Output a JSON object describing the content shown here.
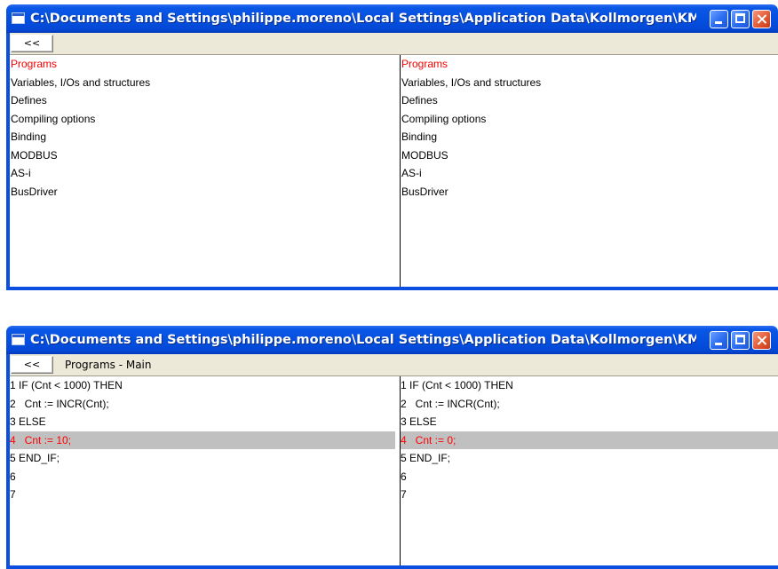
{
  "windows": [
    {
      "title": "C:\\Documents and Settings\\philippe.moreno\\Local Settings\\Application Data\\Kollmorgen\\KMS...",
      "back_label": "<<",
      "left_items": [
        "Programs",
        "Variables, I/Os and structures",
        "Defines",
        "Compiling options",
        "Binding",
        "MODBUS",
        "AS-i",
        "BusDriver"
      ],
      "right_items": [
        "Programs",
        "Variables, I/Os and structures",
        "Defines",
        "Compiling options",
        "Binding",
        "MODBUS",
        "AS-i",
        "BusDriver"
      ],
      "highlight_color": "#ff0000"
    },
    {
      "title": "C:\\Documents and Settings\\philippe.moreno\\Local Settings\\Application Data\\Kollmorgen\\KMS...",
      "back_label": "<<",
      "breadcrumb": "Programs - Main",
      "left_lines": [
        {
          "num": "1",
          "code": "IF (Cnt < 1000) THEN"
        },
        {
          "num": "2",
          "code": "  Cnt := INCR(Cnt);"
        },
        {
          "num": "3",
          "code": "ELSE"
        },
        {
          "num": "4",
          "code": "  Cnt := 10;"
        },
        {
          "num": "5",
          "code": "END_IF;"
        },
        {
          "num": "6",
          "code": ""
        },
        {
          "num": "7",
          "code": ""
        }
      ],
      "right_lines": [
        {
          "num": "1",
          "code": "IF (Cnt < 1000) THEN"
        },
        {
          "num": "2",
          "code": "  Cnt := INCR(Cnt);"
        },
        {
          "num": "3",
          "code": "ELSE"
        },
        {
          "num": "4",
          "code": "  Cnt := 0;"
        },
        {
          "num": "5",
          "code": "END_IF;"
        },
        {
          "num": "6",
          "code": ""
        },
        {
          "num": "7",
          "code": ""
        }
      ],
      "diff_line_index": 3,
      "diff_background": "#c0c0c0"
    }
  ],
  "icons": [
    "window-icon",
    "minimize-icon",
    "maximize-icon",
    "close-icon"
  ]
}
